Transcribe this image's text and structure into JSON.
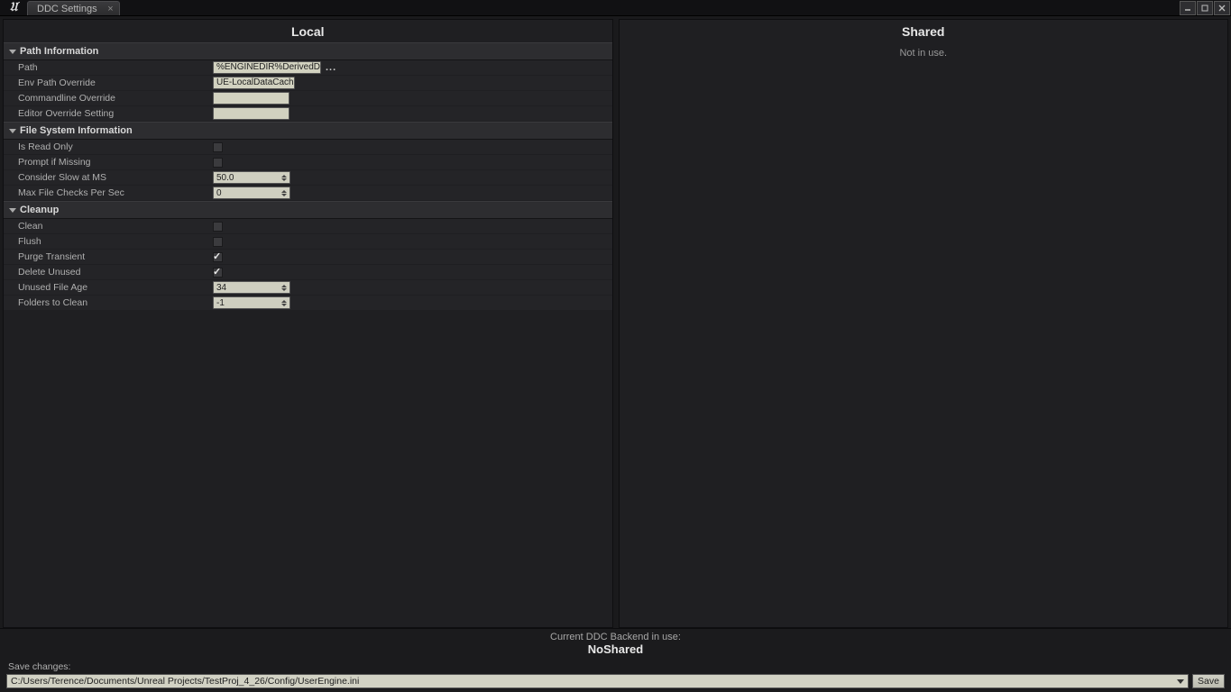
{
  "window": {
    "tab_title": "DDC Settings"
  },
  "panes": {
    "local_title": "Local",
    "shared_title": "Shared",
    "shared_msg": "Not in use."
  },
  "cats": {
    "path_info": "Path Information",
    "fs_info": "File System Information",
    "cleanup": "Cleanup"
  },
  "rows": {
    "path_label": "Path",
    "path_value": "%ENGINEDIR%DerivedDataCache",
    "env_override_label": "Env Path Override",
    "env_override_value": "UE-LocalDataCachePath",
    "cmd_override_label": "Commandline Override",
    "cmd_override_value": "",
    "editor_override_label": "Editor Override Setting",
    "editor_override_value": "",
    "readonly_label": "Is Read Only",
    "prompt_missing_label": "Prompt if Missing",
    "consider_slow_label": "Consider Slow at MS",
    "consider_slow_value": "50.0",
    "max_file_checks_label": "Max File Checks Per Sec",
    "max_file_checks_value": "0",
    "clean_label": "Clean",
    "flush_label": "Flush",
    "purge_transient_label": "Purge Transient",
    "delete_unused_label": "Delete Unused",
    "unused_age_label": "Unused File Age",
    "unused_age_value": "34",
    "folders_clean_label": "Folders to Clean",
    "folders_clean_value": "-1"
  },
  "checks": {
    "readonly": false,
    "prompt_missing": false,
    "clean": false,
    "flush": false,
    "purge_transient": true,
    "delete_unused": true
  },
  "footer": {
    "backend_label": "Current DDC Backend in use:",
    "backend_value": "NoShared",
    "save_changes_label": "Save changes:",
    "config_path": "C:/Users/Terence/Documents/Unreal Projects/TestProj_4_26/Config/UserEngine.ini",
    "save_btn": "Save"
  },
  "icons": {
    "ellipsis": "..."
  }
}
